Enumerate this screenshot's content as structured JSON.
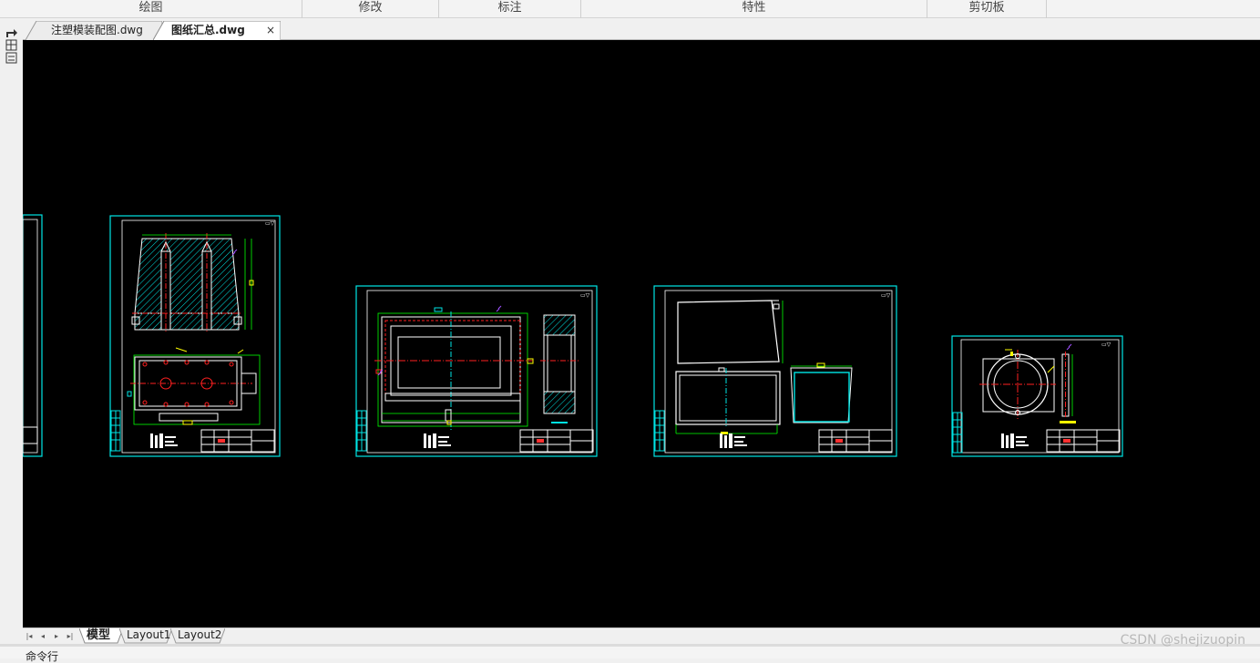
{
  "ribbon": {
    "groups": [
      "绘图",
      "修改",
      "标注",
      "特性",
      "剪切板"
    ]
  },
  "document_tabs": [
    {
      "label": "注塑模装配图.dwg",
      "active": false
    },
    {
      "label": "图纸汇总.dwg",
      "active": true,
      "close": "×"
    }
  ],
  "left_strip": {
    "icon": "sheet-set-icon",
    "label": "图纸"
  },
  "layout_tabs": {
    "nav": [
      "|◂",
      "◂",
      "▸",
      "▸|"
    ],
    "tabs": [
      "模型",
      "Layout1",
      "Layout2"
    ],
    "active": "模型"
  },
  "command_line": {
    "label": "命令行"
  },
  "watermark": "CSDN @shejizuopin",
  "colors": {
    "canvas": "#000000",
    "frame": "#00ffff",
    "hatch": "#00ffff",
    "geometry": "#ffffff",
    "centerline": "#ff0000",
    "dimension": "#00ff00",
    "accent": "#ffff00"
  }
}
